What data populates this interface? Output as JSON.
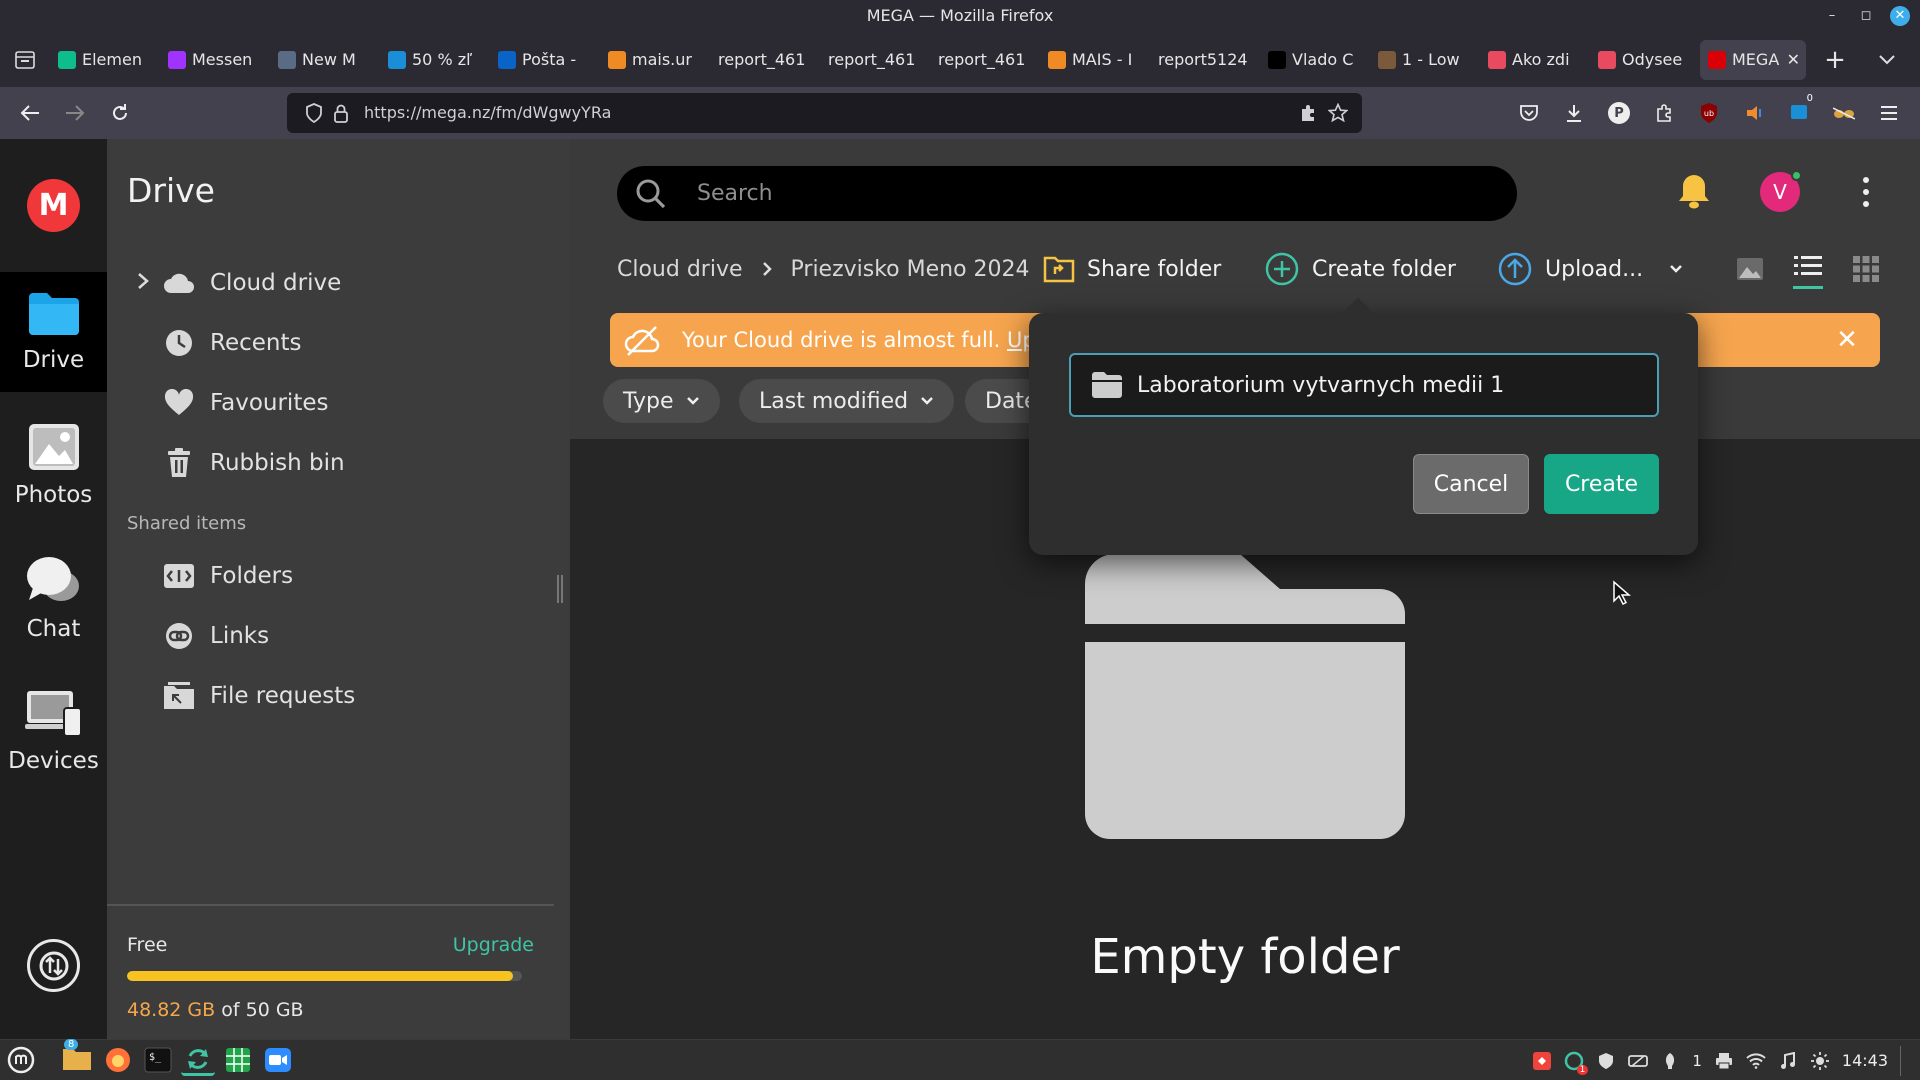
{
  "window": {
    "title": "MEGA — Mozilla Firefox"
  },
  "browser": {
    "tabs": [
      {
        "label": "Elemen",
        "icon": "element-icon",
        "color": "#0dbd8b"
      },
      {
        "label": "Messen",
        "icon": "messenger-icon",
        "color": "#a033ff"
      },
      {
        "label": "New M",
        "icon": "mail-icon",
        "color": "#5a6b85"
      },
      {
        "label": "50 % zľ",
        "icon": "video-icon",
        "color": "#1a8fd8"
      },
      {
        "label": "Pošta -",
        "icon": "outlook-icon",
        "color": "#0a64c8"
      },
      {
        "label": "mais.ur",
        "icon": "mais-icon",
        "color": "#f08a24"
      },
      {
        "label": "report_461",
        "icon": "",
        "color": ""
      },
      {
        "label": "report_461",
        "icon": "",
        "color": ""
      },
      {
        "label": "report_461",
        "icon": "",
        "color": ""
      },
      {
        "label": "MAIS - I",
        "icon": "mais-icon",
        "color": "#f08a24"
      },
      {
        "label": "report5124",
        "icon": "",
        "color": ""
      },
      {
        "label": "Vlado C",
        "icon": "x-icon",
        "color": "#000000"
      },
      {
        "label": "1 - Low",
        "icon": "profile-icon",
        "color": "#7a5a3a"
      },
      {
        "label": "Ako zdi",
        "icon": "odysee-icon",
        "color": "#e84a5f"
      },
      {
        "label": "Odysee",
        "icon": "odysee-icon",
        "color": "#e84a5f"
      },
      {
        "label": "MEGA",
        "icon": "mega-icon",
        "color": "#d90007",
        "active": true
      }
    ],
    "url": "https://mega.nz/fm/dWgwyYRa",
    "extension_badge": "0"
  },
  "rail": {
    "items": [
      {
        "label": "Drive",
        "icon": "folder-icon",
        "active": true
      },
      {
        "label": "Photos",
        "icon": "photos-icon"
      },
      {
        "label": "Chat",
        "icon": "chat-icon"
      },
      {
        "label": "Devices",
        "icon": "devices-icon"
      }
    ]
  },
  "sidebar": {
    "title": "Drive",
    "items": [
      {
        "label": "Cloud drive",
        "icon": "cloud-icon"
      },
      {
        "label": "Recents",
        "icon": "clock-icon"
      },
      {
        "label": "Favourites",
        "icon": "heart-icon"
      },
      {
        "label": "Rubbish bin",
        "icon": "trash-icon"
      }
    ],
    "shared_label": "Shared items",
    "shared_items": [
      {
        "label": "Folders",
        "icon": "shared-folder-icon"
      },
      {
        "label": "Links",
        "icon": "link-icon"
      },
      {
        "label": "File requests",
        "icon": "file-request-icon"
      }
    ],
    "storage": {
      "plan": "Free",
      "upgrade": "Upgrade",
      "used": "48.82 GB",
      "total": "of 50 GB",
      "used_fraction": 0.9764
    }
  },
  "main": {
    "search_placeholder": "Search",
    "avatar_letter": "V",
    "breadcrumb": [
      "Cloud drive",
      "Priezvisko Meno 2024"
    ],
    "toolbar": {
      "share_folder": "Share folder",
      "create_folder": "Create folder",
      "upload": "Upload..."
    },
    "banner": {
      "text": "Your Cloud drive is almost full. ",
      "link": "Up",
      "trailing": "."
    },
    "filters": [
      "Type",
      "Last modified",
      "Date"
    ],
    "empty_text": "Empty folder"
  },
  "dialog": {
    "folder_name": "Laboratorium vytvarnych medii 1",
    "cancel": "Cancel",
    "create": "Create"
  },
  "taskbar": {
    "files_badge": "8",
    "tray_badge": "1",
    "tray_count": "1",
    "clock": "14:43"
  },
  "colors": {
    "accent": "#3fc4a6",
    "create_button": "#17a787",
    "banner": "#f6a54e",
    "mega_red": "#f0373a",
    "storage_fill": "#f8c223"
  }
}
